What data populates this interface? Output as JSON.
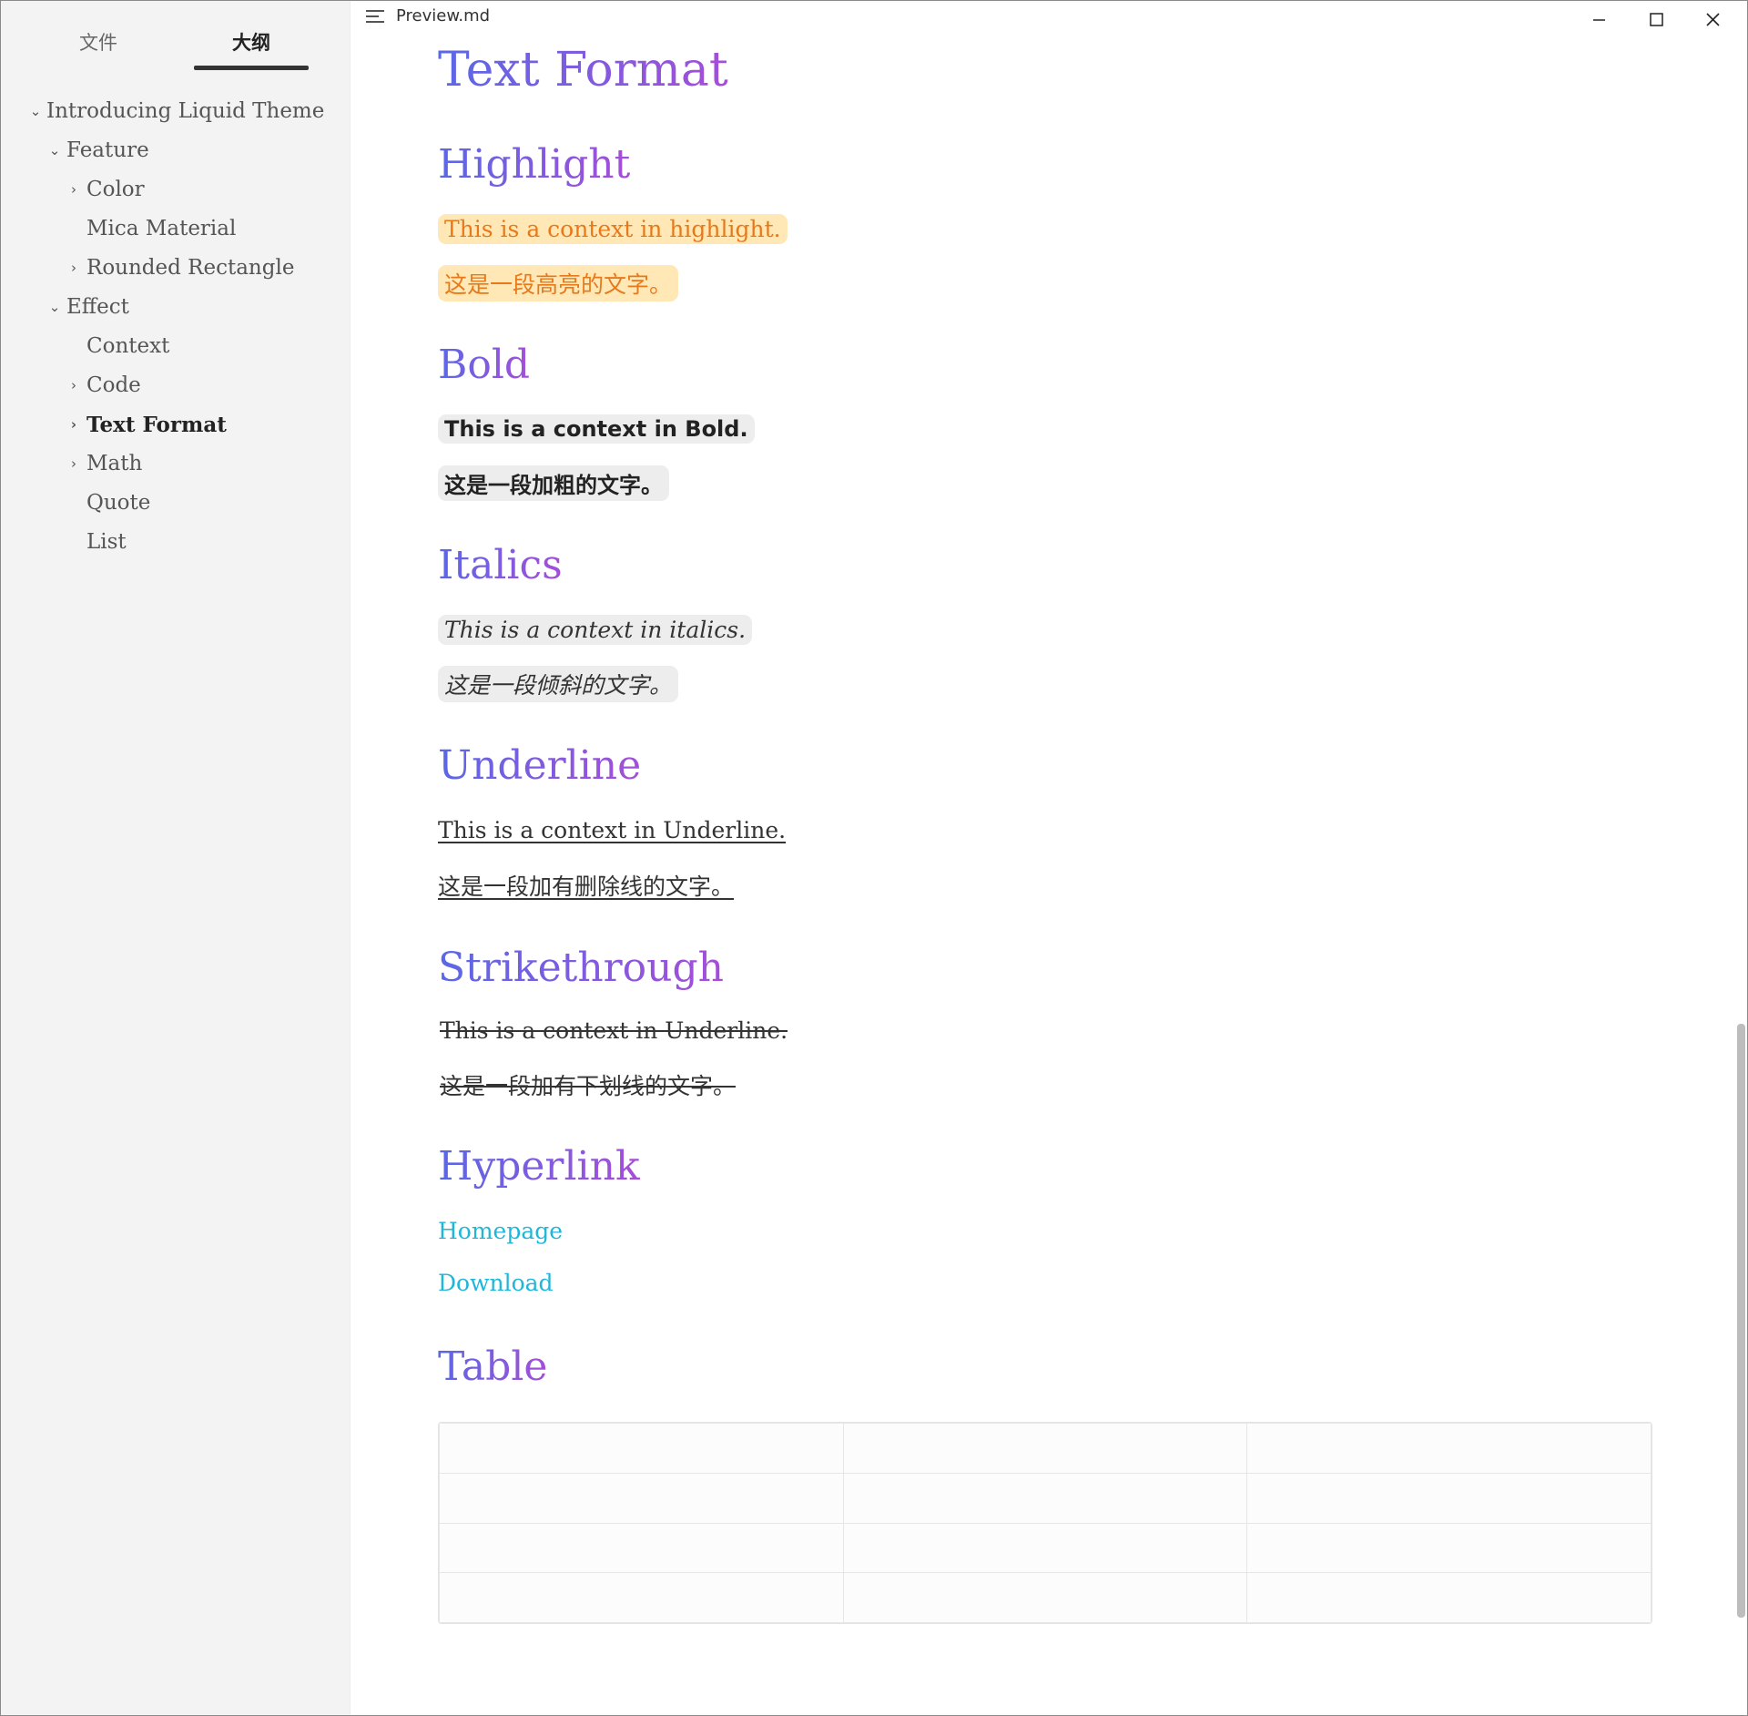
{
  "window": {
    "file_name": "Preview.md"
  },
  "sidebar": {
    "tabs": {
      "files": "文件",
      "outline": "大纲"
    },
    "outline": [
      {
        "label": "Introducing Liquid Theme",
        "level": 0,
        "chevron": "⌄"
      },
      {
        "label": "Feature",
        "level": 1,
        "chevron": "⌄"
      },
      {
        "label": "Color",
        "level": 2,
        "chevron": "›"
      },
      {
        "label": "Mica Material",
        "level": 2,
        "chevron": ""
      },
      {
        "label": "Rounded Rectangle",
        "level": 2,
        "chevron": "›"
      },
      {
        "label": "Effect",
        "level": 1,
        "chevron": "⌄"
      },
      {
        "label": "Context",
        "level": 2,
        "chevron": ""
      },
      {
        "label": "Code",
        "level": 2,
        "chevron": "›"
      },
      {
        "label": "Text Format",
        "level": 2,
        "chevron": "›",
        "active": true
      },
      {
        "label": "Math",
        "level": 2,
        "chevron": "›"
      },
      {
        "label": "Quote",
        "level": 2,
        "chevron": ""
      },
      {
        "label": "List",
        "level": 2,
        "chevron": ""
      }
    ]
  },
  "document": {
    "title": "Text Format",
    "highlight": {
      "heading": "Highlight",
      "en": "This is a context in highlight.",
      "zh": "这是一段高亮的文字。"
    },
    "bold": {
      "heading": "Bold",
      "en": "This is a context in Bold.",
      "zh": "这是一段加粗的文字。"
    },
    "italics": {
      "heading": "Italics",
      "en": "This is a context in italics.",
      "zh": "这是一段倾斜的文字。"
    },
    "underline": {
      "heading": "Underline",
      "en": "This is a context in Underline.",
      "zh": "这是一段加有删除线的文字。"
    },
    "strikethrough": {
      "heading": "Strikethrough",
      "en": "This is a context in Underline.",
      "zh": "这是一段加有下划线的文字。"
    },
    "hyperlink": {
      "heading": "Hyperlink",
      "homepage": "Homepage",
      "download": "Download"
    },
    "table": {
      "heading": "Table"
    }
  },
  "colors": {
    "heading_gradient_start": "#5a68e6",
    "heading_gradient_end": "#a54ed8",
    "highlight_bg": "#ffe8b5",
    "highlight_text": "#e7791b",
    "link": "#1fb6d9",
    "sidebar_bg": "#f3f3f3"
  },
  "icons": {
    "menu": "outline-menu-icon",
    "minimize": "minimize-icon",
    "maximize": "maximize-icon",
    "close": "close-icon"
  }
}
